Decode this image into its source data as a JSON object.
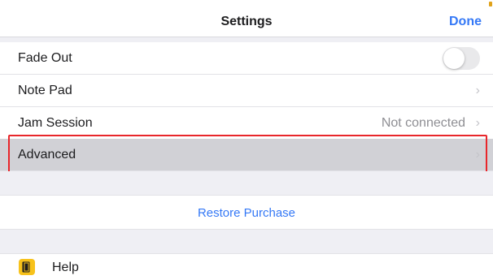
{
  "navbar": {
    "title": "Settings",
    "done_label": "Done"
  },
  "rows": {
    "fade_out": {
      "label": "Fade Out",
      "toggle_on": false
    },
    "note_pad": {
      "label": "Note Pad"
    },
    "jam_session": {
      "label": "Jam Session",
      "status": "Not connected"
    },
    "advanced": {
      "label": "Advanced"
    }
  },
  "restore_purchase": {
    "label": "Restore Purchase"
  },
  "help": {
    "label": "Help",
    "icon": "book-icon"
  },
  "colors": {
    "accent": "#3478f6",
    "highlight_border": "#e8262b",
    "help_icon_bg": "#f7c21b",
    "selected_row_bg": "#d1d1d6"
  },
  "icons": {
    "chevron": "›"
  }
}
